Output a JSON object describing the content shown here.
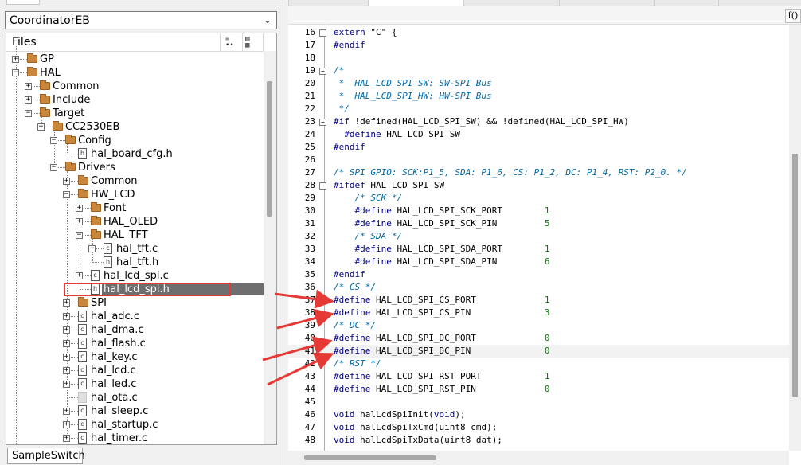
{
  "workspace": {
    "configuration": "CoordinatorEB",
    "files_header": "Files",
    "bottom_tab": "SampleSwitch"
  },
  "tree": [
    {
      "label": "GP",
      "type": "folder",
      "depth": 0,
      "expander": "+"
    },
    {
      "label": "HAL",
      "type": "folder",
      "depth": 0,
      "expander": "-"
    },
    {
      "label": "Common",
      "type": "folder",
      "depth": 1,
      "expander": "+"
    },
    {
      "label": "Include",
      "type": "folder",
      "depth": 1,
      "expander": "+"
    },
    {
      "label": "Target",
      "type": "folder",
      "depth": 1,
      "expander": "-"
    },
    {
      "label": "CC2530EB",
      "type": "folder",
      "depth": 2,
      "expander": "-"
    },
    {
      "label": "Config",
      "type": "folder",
      "depth": 3,
      "expander": "-"
    },
    {
      "label": "hal_board_cfg.h",
      "type": "h",
      "depth": 4,
      "expander": ""
    },
    {
      "label": "Drivers",
      "type": "folder",
      "depth": 3,
      "expander": "-"
    },
    {
      "label": "Common",
      "type": "folder",
      "depth": 4,
      "expander": "+"
    },
    {
      "label": "HW_LCD",
      "type": "folder",
      "depth": 4,
      "expander": "-"
    },
    {
      "label": "Font",
      "type": "folder",
      "depth": 5,
      "expander": "+"
    },
    {
      "label": "HAL_OLED",
      "type": "folder",
      "depth": 5,
      "expander": "+"
    },
    {
      "label": "HAL_TFT",
      "type": "folder",
      "depth": 5,
      "expander": "-"
    },
    {
      "label": "hal_tft.c",
      "type": "c",
      "depth": 6,
      "expander": "+"
    },
    {
      "label": "hal_tft.h",
      "type": "h",
      "depth": 6,
      "expander": ""
    },
    {
      "label": "hal_lcd_spi.c",
      "type": "c",
      "depth": 5,
      "expander": "+"
    },
    {
      "label": "hal_lcd_spi.h",
      "type": "h",
      "depth": 5,
      "expander": "",
      "selected": true
    },
    {
      "label": "SPI",
      "type": "folder",
      "depth": 4,
      "expander": "+"
    },
    {
      "label": "hal_adc.c",
      "type": "c",
      "depth": 4,
      "expander": "+"
    },
    {
      "label": "hal_dma.c",
      "type": "c",
      "depth": 4,
      "expander": "+"
    },
    {
      "label": "hal_flash.c",
      "type": "c",
      "depth": 4,
      "expander": "+"
    },
    {
      "label": "hal_key.c",
      "type": "c",
      "depth": 4,
      "expander": "+"
    },
    {
      "label": "hal_lcd.c",
      "type": "c",
      "depth": 4,
      "expander": "+"
    },
    {
      "label": "hal_led.c",
      "type": "c",
      "depth": 4,
      "expander": "+"
    },
    {
      "label": "hal_ota.c",
      "type": "blank",
      "depth": 4,
      "expander": ""
    },
    {
      "label": "hal_sleep.c",
      "type": "c",
      "depth": 4,
      "expander": "+"
    },
    {
      "label": "hal_startup.c",
      "type": "c",
      "depth": 4,
      "expander": "+"
    },
    {
      "label": "hal_timer.c",
      "type": "c",
      "depth": 4,
      "expander": "+"
    }
  ],
  "editor": {
    "function_button": "f()",
    "current_line": 41,
    "lines": [
      {
        "n": "16",
        "fold": "-",
        "segs": [
          [
            "k",
            "extern "
          ],
          [
            "t",
            "\"C\" {"
          ]
        ]
      },
      {
        "n": "17",
        "fold": "",
        "segs": [
          [
            "p",
            "#endif"
          ]
        ]
      },
      {
        "n": "18",
        "fold": "",
        "segs": []
      },
      {
        "n": "19",
        "fold": "-",
        "segs": [
          [
            "c",
            "/*"
          ]
        ]
      },
      {
        "n": "20",
        "fold": "",
        "segs": [
          [
            "c",
            " *  HAL_LCD_SPI_SW: SW-SPI Bus"
          ]
        ]
      },
      {
        "n": "21",
        "fold": "",
        "segs": [
          [
            "c",
            " *  HAL_LCD_SPI_HW: HW-SPI Bus"
          ]
        ]
      },
      {
        "n": "22",
        "fold": "",
        "segs": [
          [
            "c",
            " */"
          ]
        ]
      },
      {
        "n": "23",
        "fold": "-",
        "segs": [
          [
            "p",
            "#if "
          ],
          [
            "t",
            "!defined(HAL_LCD_SPI_SW) && !defined(HAL_LCD_SPI_HW)"
          ]
        ]
      },
      {
        "n": "24",
        "fold": "",
        "segs": [
          [
            "p",
            "  #define "
          ],
          [
            "t",
            "HAL_LCD_SPI_SW"
          ]
        ]
      },
      {
        "n": "25",
        "fold": "",
        "segs": [
          [
            "p",
            "#endif"
          ]
        ]
      },
      {
        "n": "26",
        "fold": "",
        "segs": []
      },
      {
        "n": "27",
        "fold": "",
        "segs": [
          [
            "c",
            "/* SPI GPIO: SCK:P1_5, SDA: P1_6, CS: P1_2, DC: P1_4, RST: P2_0. */"
          ]
        ]
      },
      {
        "n": "28",
        "fold": "-",
        "segs": [
          [
            "p",
            "#ifdef "
          ],
          [
            "t",
            "HAL_LCD_SPI_SW"
          ]
        ]
      },
      {
        "n": "29",
        "fold": "",
        "segs": [
          [
            "c",
            "    /* SCK */"
          ]
        ]
      },
      {
        "n": "30",
        "fold": "",
        "segs": [
          [
            "p",
            "    #define "
          ],
          [
            "t",
            "HAL_LCD_SPI_SCK_PORT        "
          ],
          [
            "n",
            "1"
          ]
        ]
      },
      {
        "n": "31",
        "fold": "",
        "segs": [
          [
            "p",
            "    #define "
          ],
          [
            "t",
            "HAL_LCD_SPI_SCK_PIN         "
          ],
          [
            "n",
            "5"
          ]
        ]
      },
      {
        "n": "32",
        "fold": "",
        "segs": [
          [
            "c",
            "    /* SDA */"
          ]
        ]
      },
      {
        "n": "33",
        "fold": "",
        "segs": [
          [
            "p",
            "    #define "
          ],
          [
            "t",
            "HAL_LCD_SPI_SDA_PORT        "
          ],
          [
            "n",
            "1"
          ]
        ]
      },
      {
        "n": "34",
        "fold": "",
        "segs": [
          [
            "p",
            "    #define "
          ],
          [
            "t",
            "HAL_LCD_SPI_SDA_PIN         "
          ],
          [
            "n",
            "6"
          ]
        ]
      },
      {
        "n": "35",
        "fold": "",
        "segs": [
          [
            "p",
            "#endif"
          ]
        ]
      },
      {
        "n": "36",
        "fold": "",
        "segs": [
          [
            "c",
            "/* CS */"
          ]
        ]
      },
      {
        "n": "37",
        "fold": "",
        "segs": [
          [
            "p",
            "#define "
          ],
          [
            "t",
            "HAL_LCD_SPI_CS_PORT             "
          ],
          [
            "n",
            "1"
          ]
        ]
      },
      {
        "n": "38",
        "fold": "",
        "segs": [
          [
            "p",
            "#define "
          ],
          [
            "t",
            "HAL_LCD_SPI_CS_PIN              "
          ],
          [
            "n",
            "3"
          ]
        ]
      },
      {
        "n": "39",
        "fold": "",
        "segs": [
          [
            "c",
            "/* DC */"
          ]
        ]
      },
      {
        "n": "40",
        "fold": "",
        "segs": [
          [
            "p",
            "#define "
          ],
          [
            "t",
            "HAL_LCD_SPI_DC_PORT             "
          ],
          [
            "n",
            "0"
          ]
        ]
      },
      {
        "n": "41",
        "fold": "",
        "segs": [
          [
            "p",
            "#define "
          ],
          [
            "t",
            "HAL_LCD_SPI_DC_PIN              "
          ],
          [
            "n",
            "0"
          ]
        ]
      },
      {
        "n": "42",
        "fold": "",
        "segs": [
          [
            "c",
            "/* RST */"
          ]
        ]
      },
      {
        "n": "43",
        "fold": "",
        "segs": [
          [
            "p",
            "#define "
          ],
          [
            "t",
            "HAL_LCD_SPI_RST_PORT            "
          ],
          [
            "n",
            "1"
          ]
        ]
      },
      {
        "n": "44",
        "fold": "",
        "segs": [
          [
            "p",
            "#define "
          ],
          [
            "t",
            "HAL_LCD_SPI_RST_PIN             "
          ],
          [
            "n",
            "0"
          ]
        ]
      },
      {
        "n": "45",
        "fold": "",
        "segs": []
      },
      {
        "n": "46",
        "fold": "",
        "segs": [
          [
            "k",
            "void "
          ],
          [
            "t",
            "halLcdSpiInit("
          ],
          [
            "k",
            "void"
          ],
          [
            "t",
            ");"
          ]
        ]
      },
      {
        "n": "47",
        "fold": "",
        "segs": [
          [
            "k",
            "void "
          ],
          [
            "t",
            "halLcdSpiTxCmd(uint8 cmd);"
          ]
        ]
      },
      {
        "n": "48",
        "fold": "",
        "segs": [
          [
            "k",
            "void "
          ],
          [
            "t",
            "halLcdSpiTxData(uint8 dat);"
          ]
        ]
      }
    ]
  },
  "colors": {
    "keyword": "#00008b",
    "comment": "#006aa8",
    "number": "#008000",
    "selection": "#6e6e6e",
    "annotation": "#e53935"
  }
}
